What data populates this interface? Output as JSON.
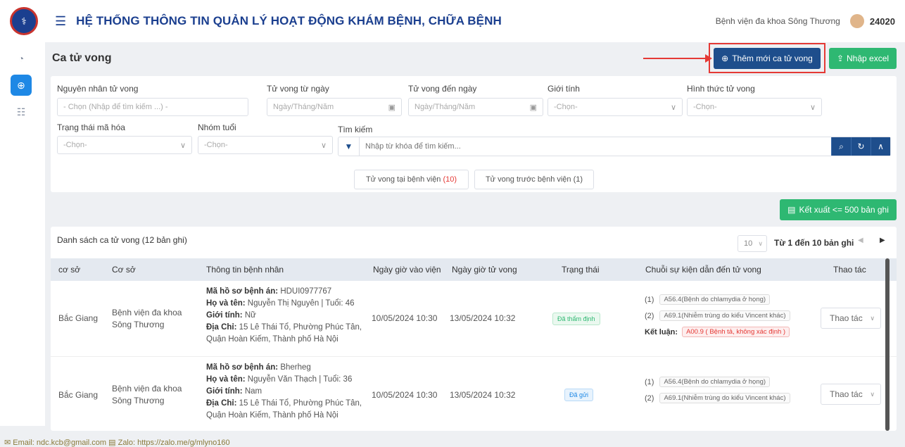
{
  "app": {
    "title": "HỆ THỐNG THÔNG TIN QUẢN LÝ HOẠT ĐỘNG KHÁM BỆNH, CHỮA BỆNH",
    "hospital": "Bệnh viện đa khoa Sông Thương",
    "user_id": "24020",
    "logo_icon": "ministry-health-logo-icon"
  },
  "colors": {
    "primary": "#1e4e8c",
    "green": "#2eb872",
    "accent": "#1e88e5",
    "red": "#e53935"
  },
  "page": {
    "title": "Ca tử vong",
    "add_button": "Thêm mới ca tử vong",
    "import_button": "Nhập excel",
    "export_button": "Kết xuất <= 500 bản ghi"
  },
  "filters": {
    "cause_label": "Nguyên nhân tử vong",
    "cause_placeholder": "- Chọn (Nhập để tìm kiếm ...) -",
    "from_date_label": "Tử vong từ ngày",
    "from_date_placeholder": "Ngày/Tháng/Năm",
    "to_date_label": "Tử vong đến ngày",
    "to_date_placeholder": "Ngày/Tháng/Năm",
    "gender_label": "Giới tính",
    "gender_value": "-Chọn-",
    "form_label": "Hình thức tử vong",
    "form_value": "-Chọn-",
    "encode_label": "Trạng thái mã hóa",
    "encode_value": "-Chọn-",
    "age_label": "Nhóm tuổi",
    "age_value": "-Chọn-",
    "search_label": "Tìm kiếm",
    "search_placeholder": "Nhập từ khóa để tìm kiếm..."
  },
  "tabs": [
    {
      "label": "Tử vong tại bệnh viện",
      "count": "(10)"
    },
    {
      "label": "Tử vong trước bệnh viện (1)",
      "count": ""
    }
  ],
  "list": {
    "title": "Danh sách ca tử vong (12 bản ghi)",
    "page_size": "10",
    "range": "Từ 1 đến 10 bản ghi",
    "columns": [
      "cơ sở",
      "Cơ sở",
      "Thông tin bệnh nhân",
      "Ngày giờ vào viện",
      "Ngày giờ tử vong",
      "Trạng thái",
      "Chuỗi sự kiện dẫn đến tử vong",
      "Thao tác"
    ],
    "rows": [
      {
        "region": "Bắc Giang",
        "facility": "Bệnh viện đa khoa Sông Thương",
        "record_label": "Mã hồ sơ bệnh án:",
        "record": "HDUI0977767",
        "name_label": "Họ và tên:",
        "name": "Nguyễn Thị Nguyên | Tuổi: 46",
        "gender_label": "Giới tính:",
        "gender": "Nữ",
        "address_label": "Địa Chỉ:",
        "address1": "15 Lê Thái Tổ, Phường Phúc Tân,",
        "address2": "Quận Hoàn Kiếm, Thành phố Hà Nội",
        "admit": "10/05/2024 10:30",
        "death": "13/05/2024 10:32",
        "status": "Đã thẩm định",
        "chain1_no": "(1)",
        "chain1": "A56.4(Bệnh do chlamydia ở họng)",
        "chain2_no": "(2)",
        "chain2": "A69.1(Nhiễm trùng do kiểu Vincent khác)",
        "conclusion_label": "Kết luận:",
        "conclusion": "A00.9 ( Bệnh tả, không xác định )",
        "action": "Thao tác"
      },
      {
        "region": "Bắc Giang",
        "facility": "Bệnh viện đa khoa Sông Thương",
        "record_label": "Mã hồ sơ bệnh án:",
        "record": "Bherheg",
        "name_label": "Họ và tên:",
        "name": "Nguyễn Văn Thạch | Tuổi: 36",
        "gender_label": "Giới tính:",
        "gender": "Nam",
        "address_label": "Địa Chỉ:",
        "address1": "15 Lê Thái Tổ, Phường Phúc Tân,",
        "address2": "Quận Hoàn Kiếm, Thành phố Hà Nội",
        "admit": "10/05/2024 10:30",
        "death": "13/05/2024 10:32",
        "status": "Đã gửi",
        "chain1_no": "(1)",
        "chain1": "A56.4(Bệnh do chlamydia ở họng)",
        "chain2_no": "(2)",
        "chain2": "A69.1(Nhiễm trùng do kiểu Vincent khác)",
        "action": "Thao tác"
      }
    ]
  },
  "footer": {
    "text": "✉ Email: ndc.kcb@gmail.com  ▤ Zalo: https://zalo.me/g/mlyno160"
  }
}
